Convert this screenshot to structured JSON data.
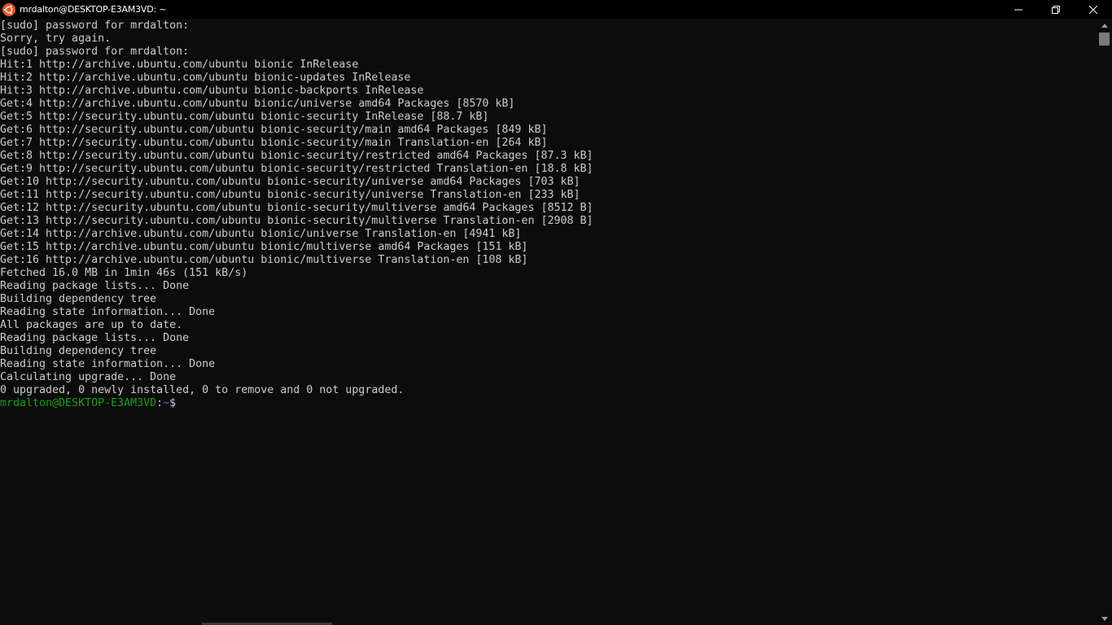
{
  "window": {
    "title": "mrdalton@DESKTOP-E3AM3VD: ~",
    "app_icon": "ubuntu-icon",
    "controls": {
      "minimize": "minimize-icon",
      "maximize": "restore-icon",
      "close": "close-icon"
    }
  },
  "colors": {
    "background": "#0c0c0c",
    "text": "#cccccc",
    "prompt_user": "#13a10e",
    "prompt_path": "#3b78ff",
    "ubuntu_orange": "#e95420"
  },
  "terminal": {
    "lines": [
      "[sudo] password for mrdalton:",
      "Sorry, try again.",
      "[sudo] password for mrdalton:",
      "Hit:1 http://archive.ubuntu.com/ubuntu bionic InRelease",
      "Hit:2 http://archive.ubuntu.com/ubuntu bionic-updates InRelease",
      "Hit:3 http://archive.ubuntu.com/ubuntu bionic-backports InRelease",
      "Get:4 http://archive.ubuntu.com/ubuntu bionic/universe amd64 Packages [8570 kB]",
      "Get:5 http://security.ubuntu.com/ubuntu bionic-security InRelease [88.7 kB]",
      "Get:6 http://security.ubuntu.com/ubuntu bionic-security/main amd64 Packages [849 kB]",
      "Get:7 http://security.ubuntu.com/ubuntu bionic-security/main Translation-en [264 kB]",
      "Get:8 http://security.ubuntu.com/ubuntu bionic-security/restricted amd64 Packages [87.3 kB]",
      "Get:9 http://security.ubuntu.com/ubuntu bionic-security/restricted Translation-en [18.8 kB]",
      "Get:10 http://security.ubuntu.com/ubuntu bionic-security/universe amd64 Packages [703 kB]",
      "Get:11 http://security.ubuntu.com/ubuntu bionic-security/universe Translation-en [233 kB]",
      "Get:12 http://security.ubuntu.com/ubuntu bionic-security/multiverse amd64 Packages [8512 B]",
      "Get:13 http://security.ubuntu.com/ubuntu bionic-security/multiverse Translation-en [2908 B]",
      "Get:14 http://archive.ubuntu.com/ubuntu bionic/universe Translation-en [4941 kB]",
      "Get:15 http://archive.ubuntu.com/ubuntu bionic/multiverse amd64 Packages [151 kB]",
      "Get:16 http://archive.ubuntu.com/ubuntu bionic/multiverse Translation-en [108 kB]",
      "Fetched 16.0 MB in 1min 46s (151 kB/s)",
      "Reading package lists... Done",
      "Building dependency tree",
      "Reading state information... Done",
      "All packages are up to date.",
      "Reading package lists... Done",
      "Building dependency tree",
      "Reading state information... Done",
      "Calculating upgrade... Done",
      "0 upgraded, 0 newly installed, 0 to remove and 0 not upgraded."
    ],
    "prompt": {
      "user_host": "mrdalton@DESKTOP-E3AM3VD",
      "separator": ":",
      "path": "~",
      "symbol": "$"
    }
  }
}
